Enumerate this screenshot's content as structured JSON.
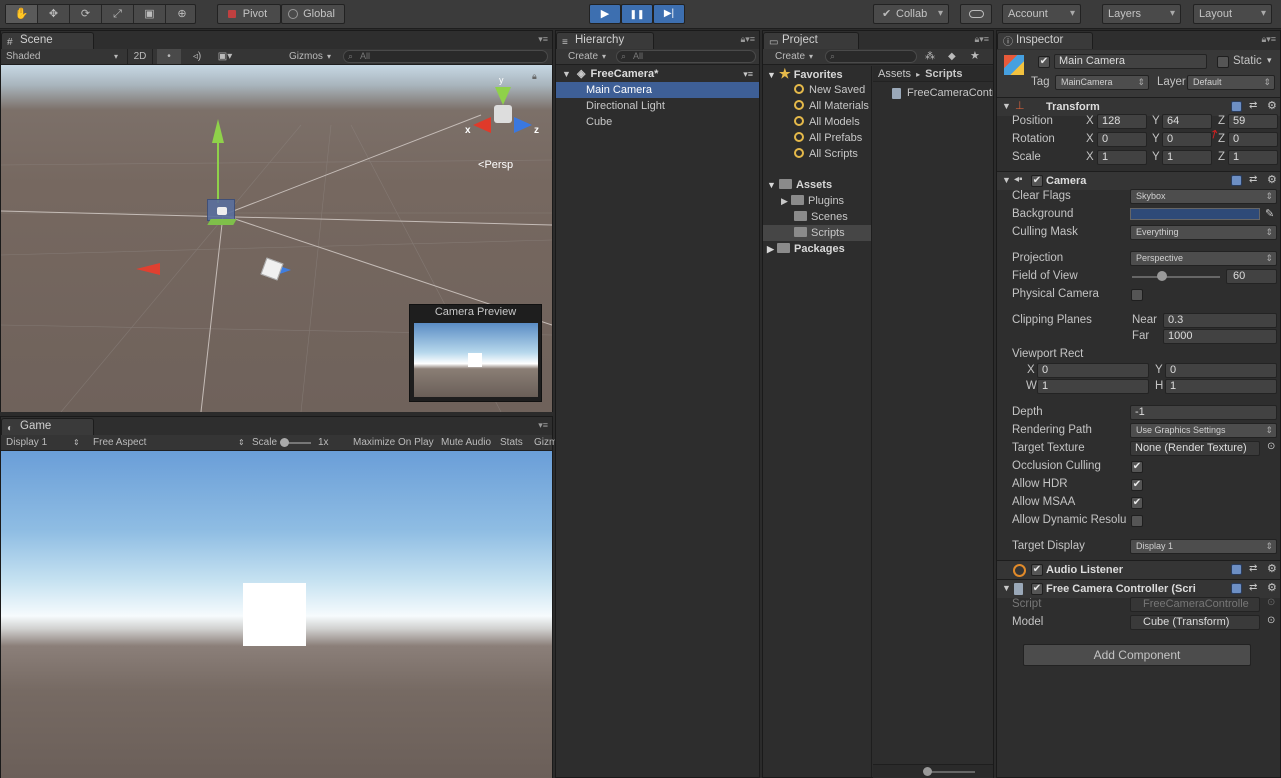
{
  "toolbar": {
    "tools": [
      "✋",
      "✥",
      "⟳",
      "⤢",
      "▣",
      "⊕"
    ],
    "pivot": "Pivot",
    "global": "Global",
    "collab": "Collab",
    "account": "Account",
    "layers": "Layers",
    "layout": "Layout",
    "play": "▶",
    "pause": "❚❚",
    "step": "▶|"
  },
  "scene": {
    "tab": "Scene",
    "shaded": "Shaded",
    "mode2d": "2D",
    "gizmos": "Gizmos",
    "search_placeholder": "All",
    "persp": "Persp",
    "axis_x": "x",
    "axis_y": "y",
    "axis_z": "z",
    "camera_preview_title": "Camera Preview"
  },
  "game": {
    "tab": "Game",
    "display": "Display 1",
    "aspect": "Free Aspect",
    "scale_label": "Scale",
    "scale_value": "1x",
    "maximize": "Maximize On Play",
    "mute": "Mute Audio",
    "stats": "Stats",
    "gizmos": "Gizm"
  },
  "hierarchy": {
    "tab": "Hierarchy",
    "create": "Create",
    "search_placeholder": "All",
    "scene_name": "FreeCamera*",
    "items": [
      "Main Camera",
      "Directional Light",
      "Cube"
    ]
  },
  "project": {
    "tab": "Project",
    "create": "Create",
    "favorites": "Favorites",
    "favorite_items": [
      "New Saved",
      "All Materials",
      "All Models",
      "All Prefabs",
      "All Scripts"
    ],
    "assets": "Assets",
    "asset_folders": [
      "Plugins",
      "Scenes",
      "Scripts"
    ],
    "packages": "Packages",
    "breadcrumb_root": "Assets",
    "breadcrumb_sep": "▸",
    "breadcrumb_current": "Scripts",
    "files": [
      "FreeCameraController"
    ]
  },
  "inspector": {
    "tab": "Inspector",
    "object_name": "Main Camera",
    "static_label": "Static",
    "tag_label": "Tag",
    "tag_value": "MainCamera",
    "layer_label": "Layer",
    "layer_value": "Default",
    "transform": {
      "title": "Transform",
      "position_label": "Position",
      "rotation_label": "Rotation",
      "scale_label": "Scale",
      "x": "X",
      "y": "Y",
      "z": "Z",
      "position": [
        "128",
        "64",
        "59"
      ],
      "rotation": [
        "0",
        "0",
        "0"
      ],
      "scale": [
        "1",
        "1",
        "1"
      ]
    },
    "camera": {
      "title": "Camera",
      "clear_flags_label": "Clear Flags",
      "clear_flags": "Skybox",
      "background_label": "Background",
      "background_color": "#2e4a78",
      "culling_mask_label": "Culling Mask",
      "culling_mask": "Everything",
      "projection_label": "Projection",
      "projection": "Perspective",
      "fov_label": "Field of View",
      "fov": "60",
      "physical_label": "Physical Camera",
      "clipping_label": "Clipping Planes",
      "near_label": "Near",
      "near": "0.3",
      "far_label": "Far",
      "far": "1000",
      "viewport_label": "Viewport Rect",
      "vp_x": "0",
      "vp_y": "0",
      "vp_w": "1",
      "vp_h": "1",
      "vp_x_label": "X",
      "vp_y_label": "Y",
      "vp_w_label": "W",
      "vp_h_label": "H",
      "depth_label": "Depth",
      "depth": "-1",
      "rendering_path_label": "Rendering Path",
      "rendering_path": "Use Graphics Settings",
      "target_texture_label": "Target Texture",
      "target_texture": "None (Render Texture)",
      "occlusion_label": "Occlusion Culling",
      "hdr_label": "Allow HDR",
      "msaa_label": "Allow MSAA",
      "dynres_label": "Allow Dynamic Resolu",
      "target_display_label": "Target Display",
      "target_display": "Display 1"
    },
    "audio_listener": "Audio Listener",
    "free_camera": {
      "title": "Free Camera Controller (Scri",
      "script_label": "Script",
      "script": "FreeCameraControlle",
      "model_label": "Model",
      "model": "Cube (Transform)"
    },
    "add_component": "Add Component"
  }
}
